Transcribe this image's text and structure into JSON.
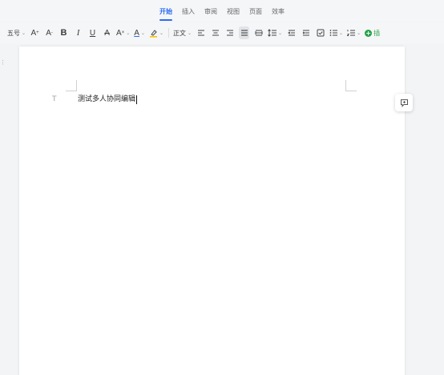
{
  "menu": {
    "tabs": [
      {
        "label": "开始",
        "active": true
      },
      {
        "label": "插入"
      },
      {
        "label": "审阅"
      },
      {
        "label": "视图"
      },
      {
        "label": "页面"
      },
      {
        "label": "效率"
      }
    ]
  },
  "toolbar": {
    "font_size": "五号",
    "increase_font_glyph": "A",
    "decrease_font_glyph": "A",
    "bold": "B",
    "italic": "I",
    "underline": "U",
    "strikethrough": "A",
    "text_effect": "A",
    "font_color": "A",
    "style": "正文",
    "insert_label": "插",
    "accent_color": "#2b6df0",
    "insert_color": "#24a148"
  },
  "document": {
    "paragraph_handle": "T",
    "text": "测试多人协同编辑"
  },
  "icons": {
    "comment": "comment-icon",
    "highlight": "highlighter-icon"
  }
}
